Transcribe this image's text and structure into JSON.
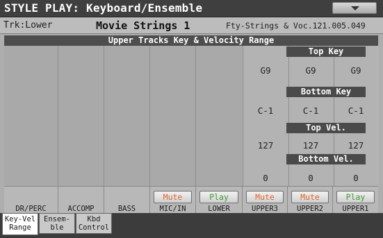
{
  "window": {
    "title": "STYLE PLAY: Keyboard/Ensemble"
  },
  "info": {
    "track": "Trk:Lower",
    "sound_name": "Movie Strings 1",
    "sound_id": "Fty-Strings & Voc.121.005.049"
  },
  "panel": {
    "title": "Upper Tracks Key & Velocity Range",
    "sections": {
      "top_key": "Top Key",
      "bottom_key": "Bottom Key",
      "top_vel": "Top Vel.",
      "bottom_vel": "Bottom Vel."
    },
    "values": {
      "top_key": [
        "G9",
        "G9",
        "G9"
      ],
      "bottom_key": [
        "C-1",
        "C-1",
        "C-1"
      ],
      "top_vel": [
        "127",
        "127",
        "127"
      ],
      "bottom_vel": [
        "0",
        "0",
        "0"
      ]
    }
  },
  "tracks": [
    {
      "name": "DR/PERC",
      "button": ""
    },
    {
      "name": "ACCOMP",
      "button": ""
    },
    {
      "name": "BASS",
      "button": ""
    },
    {
      "name": "MIC/IN",
      "button": "Mute"
    },
    {
      "name": "LOWER",
      "button": "Play"
    },
    {
      "name": "UPPER3",
      "button": "Mute"
    },
    {
      "name": "UPPER2",
      "button": "Mute"
    },
    {
      "name": "UPPER1",
      "button": "Play"
    }
  ],
  "tabs": [
    {
      "line1": "Key-Vel",
      "line2": "Range",
      "active": true
    },
    {
      "line1": "Ensem-",
      "line2": "ble",
      "active": false
    },
    {
      "line1": "Kbd",
      "line2": "Control",
      "active": false
    }
  ],
  "colors": {
    "mute": "#e0672c",
    "play": "#3d9c34",
    "title_bg": "#3f3f3f"
  }
}
